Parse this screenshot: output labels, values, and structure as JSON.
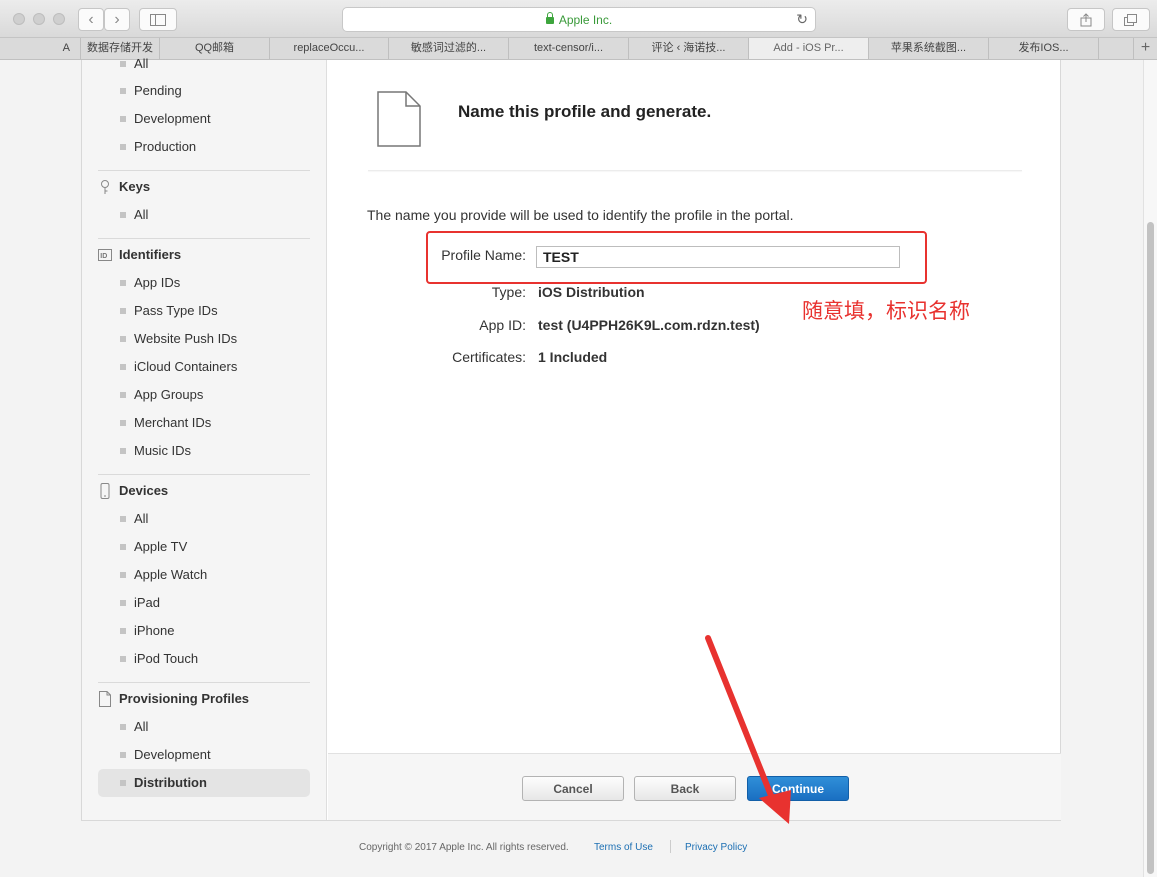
{
  "browser": {
    "address_text": "Apple Inc.",
    "tabs": [
      "A",
      "数据存储开发",
      "QQ邮箱",
      "replaceOccu...",
      "敏感词过滤的...",
      "text-censor/i...",
      "评论 ‹ 海诺技...",
      "Add - iOS Pr...",
      "苹果系统截图...",
      "发布IOS..."
    ]
  },
  "sidebar": {
    "certificates_items": [
      "All",
      "Pending",
      "Development",
      "Production"
    ],
    "keys": {
      "title": "Keys",
      "items": [
        "All"
      ]
    },
    "identifiers": {
      "title": "Identifiers",
      "items": [
        "App IDs",
        "Pass Type IDs",
        "Website Push IDs",
        "iCloud Containers",
        "App Groups",
        "Merchant IDs",
        "Music IDs"
      ]
    },
    "devices": {
      "title": "Devices",
      "items": [
        "All",
        "Apple TV",
        "Apple Watch",
        "iPad",
        "iPhone",
        "iPod Touch"
      ]
    },
    "profiles": {
      "title": "Provisioning Profiles",
      "items": [
        "All",
        "Development",
        "Distribution"
      ]
    }
  },
  "main": {
    "title": "Name this profile and generate.",
    "description": "The name you provide will be used to identify the profile in the portal.",
    "profile_name_label": "Profile Name:",
    "profile_name_value": "TEST",
    "type_label": "Type:",
    "type_value": "iOS Distribution",
    "appid_label": "App ID:",
    "appid_value": "test (U4PPH26K9L.com.rdzn.test)",
    "certs_label": "Certificates:",
    "certs_value": "1 Included",
    "annotation": "随意填，标识名称"
  },
  "buttons": {
    "cancel": "Cancel",
    "back": "Back",
    "continue": "Continue"
  },
  "footer": {
    "copyright": "Copyright © 2017 Apple Inc. All rights reserved.",
    "terms": "Terms of Use",
    "privacy": "Privacy Policy"
  },
  "colors": {
    "annotation_red": "#e8322f",
    "primary_blue": "#1a6fc2",
    "link_blue": "#1c6fb3"
  }
}
